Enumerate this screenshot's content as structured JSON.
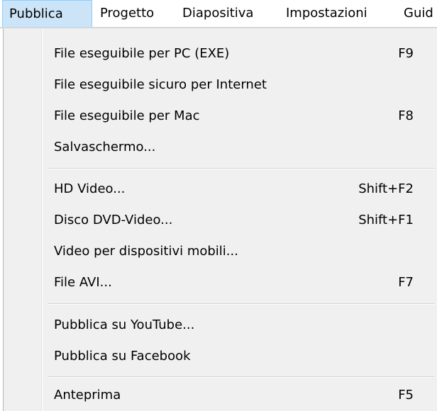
{
  "menubar": {
    "items": [
      {
        "label": "Pubblica",
        "active": true
      },
      {
        "label": "Progetto"
      },
      {
        "label": "Diapositiva"
      },
      {
        "label": "Impostazioni"
      },
      {
        "label": "Guid"
      }
    ]
  },
  "menu": {
    "items": [
      {
        "label": "File eseguibile per PC (EXE)",
        "shortcut": "F9"
      },
      {
        "label": "File eseguibile sicuro per Internet",
        "shortcut": ""
      },
      {
        "label": "File eseguibile per Mac",
        "shortcut": "F8"
      },
      {
        "label": "Salvaschermo...",
        "shortcut": ""
      },
      {
        "label": "HD Video...",
        "shortcut": "Shift+F2"
      },
      {
        "label": "Disco DVD-Video...",
        "shortcut": "Shift+F1"
      },
      {
        "label": "Video per dispositivi mobili...",
        "shortcut": ""
      },
      {
        "label": "File AVI...",
        "shortcut": "F7"
      },
      {
        "label": "Pubblica su YouTube...",
        "shortcut": ""
      },
      {
        "label": "Pubblica su Facebook",
        "shortcut": ""
      },
      {
        "label": "Anteprima",
        "shortcut": "F5"
      }
    ]
  },
  "colors": {
    "menu_background": "#f0f0f0",
    "active_menubar_item": "#cce4f7",
    "active_menubar_border": "#99c9ef"
  }
}
